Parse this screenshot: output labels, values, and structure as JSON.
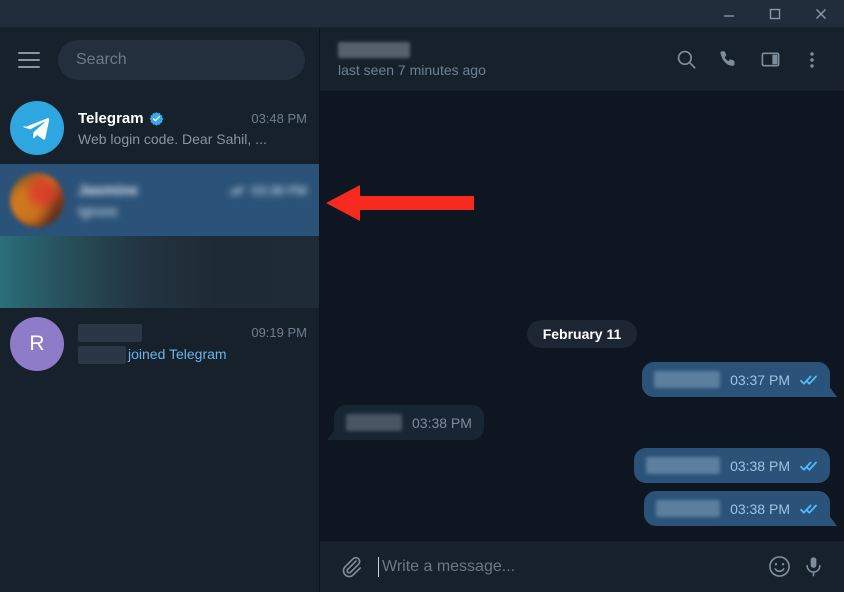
{
  "window": {
    "minimize_label": "Minimize",
    "maximize_label": "Maximize",
    "close_label": "Close"
  },
  "sidebar": {
    "menu_icon": "hamburger-menu-icon",
    "search": {
      "placeholder": "Search",
      "value": ""
    },
    "chats": [
      {
        "name": "Telegram",
        "verified": true,
        "time": "03:48 PM",
        "preview": "Web login code. Dear Sahil, ...",
        "avatar_type": "telegram-logo",
        "avatar_letter": "",
        "selected": false,
        "redacted": false,
        "preview_is_link": false,
        "has_ticks": false
      },
      {
        "name": "Jasmine",
        "verified": false,
        "time": "03:38 PM",
        "preview": "Ignore",
        "avatar_type": "photo",
        "avatar_letter": "",
        "selected": true,
        "redacted": true,
        "preview_is_link": false,
        "has_ticks": true
      },
      {
        "name": "",
        "verified": false,
        "time": "",
        "preview": "",
        "avatar_type": "gradient-placeholder",
        "avatar_letter": "",
        "selected": false,
        "redacted": true,
        "preview_is_link": false,
        "has_ticks": false
      },
      {
        "name": "",
        "verified": false,
        "time": "09:19 PM",
        "preview": "joined Telegram",
        "avatar_type": "letter",
        "avatar_letter": "R",
        "selected": false,
        "redacted": true,
        "preview_is_link": true,
        "has_ticks": false
      }
    ]
  },
  "chat_header": {
    "title": "",
    "title_redacted": true,
    "status": "last seen 7 minutes ago",
    "icons": [
      {
        "name": "search-icon",
        "label": "Search messages"
      },
      {
        "name": "phone-icon",
        "label": "Call"
      },
      {
        "name": "panel-icon",
        "label": "Toggle info panel"
      },
      {
        "name": "more-vertical-icon",
        "label": "More options"
      }
    ]
  },
  "conversation": {
    "date_divider": "February 11",
    "messages": [
      {
        "direction": "out",
        "text": "",
        "redacted": true,
        "time": "03:37 PM",
        "ticks": "double",
        "redact_width": 66,
        "tail": true
      },
      {
        "direction": "in",
        "text": "",
        "redacted": true,
        "time": "03:38 PM",
        "ticks": "none",
        "redact_width": 56,
        "tail": true
      },
      {
        "direction": "out",
        "text": "",
        "redacted": true,
        "time": "03:38 PM",
        "ticks": "double",
        "redact_width": 74,
        "tail": false
      },
      {
        "direction": "out",
        "text": "",
        "redacted": true,
        "time": "03:38 PM",
        "ticks": "double",
        "redact_width": 64,
        "tail": true
      }
    ]
  },
  "composer": {
    "attach_icon": "paperclip-icon",
    "placeholder": "Write a message...",
    "value": "",
    "emoji_icon": "emoji-smiley-icon",
    "voice_icon": "microphone-icon"
  },
  "annotation": {
    "type": "arrow",
    "direction": "left",
    "color": "#f8291f",
    "points_at": "chat-row-jasmine"
  },
  "colors": {
    "sidebar_bg": "#17212b",
    "chat_bg": "#0e1621",
    "titlebar_bg": "#212d3b",
    "selected_row": "#2b5278",
    "bubble_out": "#2b5278",
    "bubble_in": "#182533",
    "accent": "#2ea6e0",
    "tick_blue": "#4fbcf7",
    "link_blue": "#6bb3e8",
    "annotation_red": "#f8291f"
  }
}
